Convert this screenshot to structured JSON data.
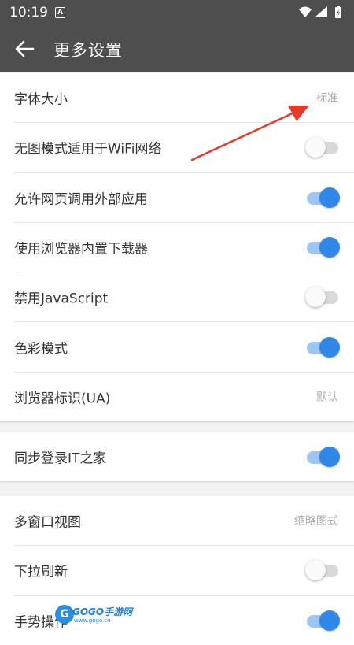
{
  "statusbar": {
    "time": "10:19",
    "notification_icon": "A"
  },
  "appbar": {
    "title": "更多设置"
  },
  "sections": [
    {
      "items": [
        {
          "label": "字体大小",
          "value": "标准"
        },
        {
          "label": "无图模式适用于WiFi网络",
          "toggle": "off"
        },
        {
          "label": "允许网页调用外部应用",
          "toggle": "on"
        },
        {
          "label": "使用浏览器内置下载器",
          "toggle": "on"
        },
        {
          "label": "禁用JavaScript",
          "toggle": "off"
        },
        {
          "label": "色彩模式",
          "toggle": "on"
        },
        {
          "label": "浏览器标识(UA)",
          "value": "默认"
        }
      ]
    },
    {
      "items": [
        {
          "label": "同步登录IT之家",
          "toggle": "on"
        }
      ]
    },
    {
      "items": [
        {
          "label": "多窗口视图",
          "value": "缩略图式"
        },
        {
          "label": "下拉刷新",
          "toggle": "off"
        },
        {
          "label": "手势操作",
          "toggle": "on"
        }
      ]
    }
  ],
  "watermark": {
    "brand": "GOGO手游网",
    "letter": "G",
    "url": "www.gogo.cn"
  },
  "colors": {
    "appbar": "#4e4e4e",
    "accent": "#2f87e8",
    "annotation_arrow": "#e53a2a"
  }
}
